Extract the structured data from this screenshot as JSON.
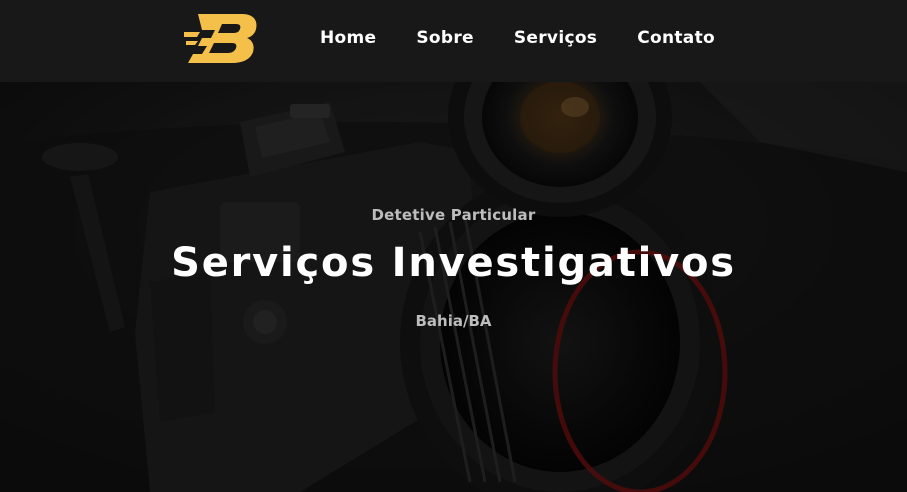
{
  "brand": {
    "logo_icon": "bolt-letter-b-logo",
    "accent_color": "#f5c04a"
  },
  "nav": {
    "items": [
      {
        "label": "Home"
      },
      {
        "label": "Sobre"
      },
      {
        "label": "Serviços"
      },
      {
        "label": "Contato"
      }
    ]
  },
  "hero": {
    "background_image": "dark camera and lens photo",
    "eyebrow": "Detetive Particular",
    "title": "Serviços Investigativos",
    "location": "Bahia/BA"
  }
}
